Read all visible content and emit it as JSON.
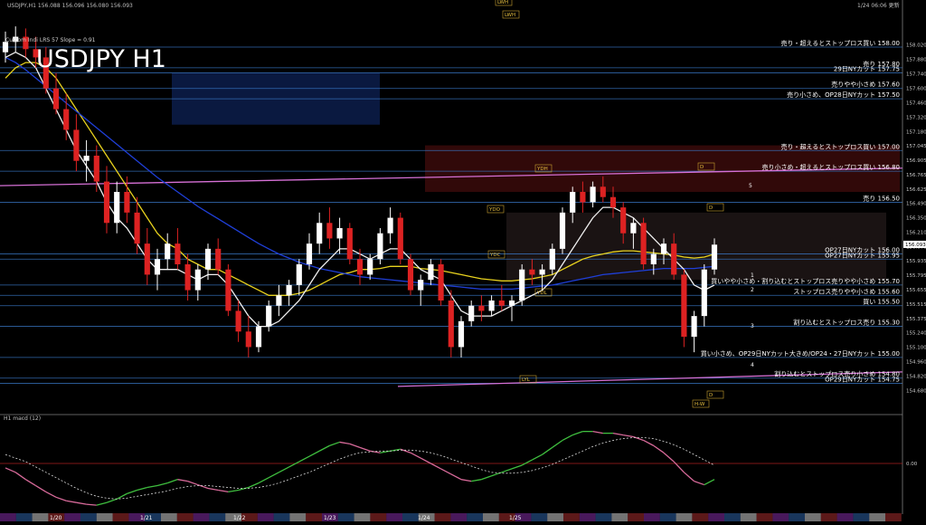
{
  "header": {
    "symbol_line": "USDJPY,H1 156.088 156.096 156.080 156.093",
    "datetime": "1/24 06:06 更新",
    "big_title": "USDJPY H1",
    "indicator_note": "Custom Indi LRS 57 Slope = 0.91",
    "lower_panel_label": "H1 macd (12)"
  },
  "colors": {
    "background": "#000000",
    "bull_candle": "#ffffff",
    "bear_candle": "#dd2222",
    "level_line": "#3a78c8",
    "sma_yellow": "#e8d21e",
    "sma_blue": "#1f3fd8",
    "sma_white": "#f0f0f0",
    "trend_pink": "#d670d6",
    "macd_green": "#3fbf3f",
    "macd_pink": "#d86a9a"
  },
  "chart_data": [
    {
      "type": "line",
      "title": "USDJPY H1",
      "ylim": [
        154.5,
        158.35
      ],
      "price_axis_ticks": [
        "158.020",
        "157.880",
        "157.740",
        "157.600",
        "157.460",
        "157.320",
        "157.180",
        "157.045",
        "156.905",
        "156.765",
        "156.625",
        "156.490",
        "156.350",
        "156.210",
        "156.070",
        "155.935",
        "155.795",
        "155.655",
        "155.515",
        "155.375",
        "155.240",
        "155.100",
        "154.960",
        "154.820",
        "154.680"
      ],
      "current_price_label": "156.093",
      "date_labels": [
        "1/20",
        "1/21",
        "1/22",
        "1/23",
        "1/24",
        "1/25"
      ],
      "levels": [
        {
          "price": 158.0,
          "label": "売り・超えるとストップロス買い 158.00"
        },
        {
          "price": 157.8,
          "label": "売り 157.80"
        },
        {
          "price": 157.75,
          "label": "29日NYカット 157.75"
        },
        {
          "price": 157.6,
          "label": "売りやや小さめ 157.60"
        },
        {
          "price": 157.5,
          "label": "売り小さめ、OP28日NYカット 157.50"
        },
        {
          "price": 157.0,
          "label": "売り・超えるとストップロス買い 157.00"
        },
        {
          "price": 156.8,
          "label": "売り小さめ・超えるとストップロス買い 156.80"
        },
        {
          "price": 156.5,
          "label": "売り 156.50"
        },
        {
          "price": 156.0,
          "label": "OP27日NYカット 156.00"
        },
        {
          "price": 155.95,
          "label": "OP27日NYカット 155.95"
        },
        {
          "price": 155.7,
          "label": "買いやや小さめ・割り込むとストップロス売りやや小さめ 155.70"
        },
        {
          "price": 155.6,
          "label": "ストップロス売りやや小さめ 155.60"
        },
        {
          "price": 155.5,
          "label": "買い 155.50"
        },
        {
          "price": 155.3,
          "label": "割り込むとストップロス売り 155.30"
        },
        {
          "price": 155.0,
          "label": "買い小さめ、OP29日NYカット大きめ/OP24・27日NYカット 155.00"
        },
        {
          "price": 154.8,
          "label": "割り込むとストップロス売り小さめ 154.80"
        },
        {
          "price": 154.75,
          "label": "OP29日NYカット 154.75"
        }
      ],
      "markers": [
        "LWH",
        "LWH",
        "YDH",
        "YDO",
        "YDC",
        "YDL",
        "LYL",
        "D",
        "D",
        "D",
        "H-W"
      ],
      "wave_labels": [
        "1",
        "2",
        "3",
        "4",
        "5"
      ],
      "candles": [
        [
          157.95,
          158.15,
          157.85,
          158.05
        ],
        [
          158.05,
          158.2,
          157.95,
          158.1
        ],
        [
          158.1,
          158.18,
          157.9,
          157.98
        ],
        [
          157.98,
          158.1,
          157.8,
          157.9
        ],
        [
          157.9,
          158.0,
          157.55,
          157.6
        ],
        [
          157.6,
          157.75,
          157.35,
          157.4
        ],
        [
          157.4,
          157.55,
          157.1,
          157.2
        ],
        [
          157.2,
          157.35,
          156.8,
          156.9
        ],
        [
          156.9,
          157.1,
          156.7,
          156.95
        ],
        [
          156.95,
          157.05,
          156.6,
          156.7
        ],
        [
          156.7,
          156.85,
          156.2,
          156.3
        ],
        [
          156.3,
          156.7,
          156.2,
          156.6
        ],
        [
          156.6,
          156.75,
          156.3,
          156.4
        ],
        [
          156.4,
          156.55,
          156.0,
          156.1
        ],
        [
          156.1,
          156.25,
          155.7,
          155.8
        ],
        [
          155.8,
          156.05,
          155.65,
          155.95
        ],
        [
          155.95,
          156.2,
          155.85,
          156.1
        ],
        [
          156.1,
          156.25,
          155.85,
          155.9
        ],
        [
          155.9,
          156.0,
          155.55,
          155.65
        ],
        [
          155.65,
          155.9,
          155.55,
          155.85
        ],
        [
          155.85,
          156.1,
          155.75,
          156.05
        ],
        [
          156.05,
          156.15,
          155.8,
          155.85
        ],
        [
          155.85,
          155.9,
          155.4,
          155.45
        ],
        [
          155.45,
          155.55,
          155.15,
          155.25
        ],
        [
          155.25,
          155.4,
          155.0,
          155.1
        ],
        [
          155.1,
          155.35,
          155.05,
          155.3
        ],
        [
          155.3,
          155.55,
          155.25,
          155.5
        ],
        [
          155.5,
          155.7,
          155.4,
          155.6
        ],
        [
          155.6,
          155.75,
          155.5,
          155.7
        ],
        [
          155.7,
          155.95,
          155.6,
          155.9
        ],
        [
          155.9,
          156.2,
          155.85,
          156.1
        ],
        [
          156.1,
          156.4,
          156.0,
          156.3
        ],
        [
          156.3,
          156.45,
          156.05,
          156.15
        ],
        [
          156.15,
          156.35,
          156.0,
          156.25
        ],
        [
          156.25,
          156.3,
          155.9,
          155.95
        ],
        [
          155.95,
          156.05,
          155.7,
          155.8
        ],
        [
          155.8,
          156.0,
          155.75,
          155.95
        ],
        [
          155.95,
          156.25,
          155.9,
          156.2
        ],
        [
          156.2,
          156.45,
          156.1,
          156.35
        ],
        [
          156.35,
          156.4,
          155.9,
          155.95
        ],
        [
          155.95,
          156.0,
          155.6,
          155.65
        ],
        [
          155.65,
          155.8,
          155.5,
          155.75
        ],
        [
          155.75,
          155.95,
          155.7,
          155.9
        ],
        [
          155.9,
          155.95,
          155.5,
          155.55
        ],
        [
          155.55,
          155.65,
          155.0,
          155.1
        ],
        [
          155.1,
          155.4,
          155.0,
          155.35
        ],
        [
          155.35,
          155.55,
          155.3,
          155.5
        ],
        [
          155.5,
          155.6,
          155.35,
          155.45
        ],
        [
          155.45,
          155.6,
          155.4,
          155.55
        ],
        [
          155.55,
          155.7,
          155.45,
          155.5
        ],
        [
          155.5,
          155.6,
          155.35,
          155.55
        ],
        [
          155.55,
          155.9,
          155.5,
          155.85
        ],
        [
          155.85,
          155.95,
          155.7,
          155.8
        ],
        [
          155.8,
          155.9,
          155.65,
          155.85
        ],
        [
          155.85,
          156.1,
          155.8,
          156.05
        ],
        [
          156.05,
          156.45,
          156.0,
          156.4
        ],
        [
          156.4,
          156.65,
          156.3,
          156.6
        ],
        [
          156.6,
          156.7,
          156.4,
          156.5
        ],
        [
          156.5,
          156.7,
          156.45,
          156.65
        ],
        [
          156.65,
          156.75,
          156.5,
          156.55
        ],
        [
          156.55,
          156.65,
          156.35,
          156.45
        ],
        [
          156.45,
          156.5,
          156.1,
          156.2
        ],
        [
          156.2,
          156.35,
          156.05,
          156.3
        ],
        [
          156.3,
          156.35,
          155.85,
          155.9
        ],
        [
          155.9,
          156.05,
          155.8,
          156.0
        ],
        [
          156.0,
          156.15,
          155.9,
          156.1
        ],
        [
          156.1,
          156.2,
          155.75,
          155.8
        ],
        [
          155.8,
          155.85,
          155.1,
          155.2
        ],
        [
          155.2,
          155.45,
          155.05,
          155.4
        ],
        [
          155.4,
          155.9,
          155.3,
          155.85
        ],
        [
          155.85,
          156.15,
          155.8,
          156.09
        ]
      ],
      "series": [
        {
          "name": "",
          "values": [
            157.7,
            157.8,
            157.85,
            157.85,
            157.8,
            157.7,
            157.55,
            157.4,
            157.25,
            157.1,
            156.95,
            156.8,
            156.65,
            156.5,
            156.35,
            156.2,
            156.1,
            156.05,
            155.95,
            155.9,
            155.85,
            155.85,
            155.8,
            155.75,
            155.7,
            155.65,
            155.6,
            155.6,
            155.6,
            155.62,
            155.65,
            155.7,
            155.75,
            155.8,
            155.82,
            155.85,
            155.85,
            155.86,
            155.88,
            155.88,
            155.88,
            155.86,
            155.85,
            155.84,
            155.82,
            155.8,
            155.78,
            155.76,
            155.75,
            155.74,
            155.74,
            155.75,
            155.76,
            155.78,
            155.8,
            155.85,
            155.9,
            155.95,
            155.98,
            156.0,
            156.02,
            156.03,
            156.03,
            156.02,
            156.01,
            156.0,
            155.99,
            155.97,
            155.96,
            155.97,
            156.0
          ]
        },
        {
          "name": "",
          "values": [
            157.9,
            157.85,
            157.78,
            157.7,
            157.62,
            157.54,
            157.46,
            157.38,
            157.3,
            157.22,
            157.14,
            157.06,
            156.98,
            156.9,
            156.82,
            156.74,
            156.67,
            156.6,
            156.53,
            156.46,
            156.4,
            156.34,
            156.28,
            156.22,
            156.16,
            156.1,
            156.05,
            156.0,
            155.96,
            155.92,
            155.89,
            155.86,
            155.84,
            155.82,
            155.8,
            155.78,
            155.77,
            155.76,
            155.75,
            155.74,
            155.73,
            155.72,
            155.71,
            155.7,
            155.69,
            155.68,
            155.67,
            155.66,
            155.66,
            155.66,
            155.66,
            155.67,
            155.68,
            155.69,
            155.7,
            155.72,
            155.74,
            155.76,
            155.78,
            155.8,
            155.81,
            155.82,
            155.83,
            155.84,
            155.85,
            155.86,
            155.86,
            155.86,
            155.86,
            155.87,
            155.88
          ]
        },
        {
          "name": "",
          "values": [
            157.9,
            157.95,
            157.9,
            157.8,
            157.6,
            157.4,
            157.2,
            157.0,
            156.85,
            156.7,
            156.5,
            156.35,
            156.25,
            156.1,
            155.95,
            155.85,
            155.85,
            155.85,
            155.8,
            155.75,
            155.8,
            155.8,
            155.7,
            155.55,
            155.4,
            155.3,
            155.3,
            155.35,
            155.45,
            155.55,
            155.7,
            155.85,
            155.95,
            156.05,
            156.05,
            156.0,
            155.95,
            156.0,
            156.05,
            156.05,
            155.95,
            155.85,
            155.8,
            155.75,
            155.6,
            155.45,
            155.4,
            155.4,
            155.4,
            155.45,
            155.5,
            155.55,
            155.6,
            155.65,
            155.75,
            155.9,
            156.05,
            156.2,
            156.35,
            156.45,
            156.45,
            156.4,
            156.35,
            156.25,
            156.15,
            156.05,
            155.95,
            155.85,
            155.7,
            155.65,
            155.7
          ]
        }
      ]
    },
    {
      "type": "line",
      "title": "H1 macd (12)",
      "axis_labels": [
        "0.00"
      ],
      "series": [
        {
          "name": "",
          "values": [
            -0.05,
            -0.1,
            -0.18,
            -0.25,
            -0.32,
            -0.38,
            -0.42,
            -0.44,
            -0.46,
            -0.47,
            -0.44,
            -0.4,
            -0.34,
            -0.3,
            -0.27,
            -0.25,
            -0.22,
            -0.18,
            -0.2,
            -0.24,
            -0.28,
            -0.3,
            -0.32,
            -0.3,
            -0.27,
            -0.22,
            -0.16,
            -0.1,
            -0.04,
            0.02,
            0.08,
            0.14,
            0.2,
            0.24,
            0.22,
            0.18,
            0.14,
            0.12,
            0.14,
            0.16,
            0.12,
            0.06,
            0.0,
            -0.06,
            -0.12,
            -0.18,
            -0.2,
            -0.18,
            -0.14,
            -0.1,
            -0.06,
            -0.02,
            0.04,
            0.1,
            0.18,
            0.26,
            0.32,
            0.36,
            0.36,
            0.34,
            0.34,
            0.32,
            0.3,
            0.26,
            0.2,
            0.12,
            0.02,
            -0.1,
            -0.2,
            -0.24,
            -0.18
          ]
        },
        {
          "name": "",
          "values": [
            0.1,
            0.06,
            0.02,
            -0.04,
            -0.1,
            -0.16,
            -0.22,
            -0.28,
            -0.33,
            -0.37,
            -0.39,
            -0.4,
            -0.39,
            -0.37,
            -0.35,
            -0.33,
            -0.31,
            -0.28,
            -0.26,
            -0.25,
            -0.25,
            -0.26,
            -0.27,
            -0.28,
            -0.28,
            -0.27,
            -0.25,
            -0.22,
            -0.18,
            -0.14,
            -0.1,
            -0.05,
            0.0,
            0.05,
            0.09,
            0.12,
            0.13,
            0.14,
            0.14,
            0.15,
            0.15,
            0.14,
            0.12,
            0.09,
            0.05,
            0.01,
            -0.03,
            -0.07,
            -0.1,
            -0.11,
            -0.11,
            -0.1,
            -0.08,
            -0.05,
            -0.01,
            0.04,
            0.09,
            0.14,
            0.19,
            0.23,
            0.26,
            0.28,
            0.29,
            0.29,
            0.28,
            0.25,
            0.21,
            0.16,
            0.1,
            0.04,
            -0.02
          ]
        }
      ]
    }
  ]
}
